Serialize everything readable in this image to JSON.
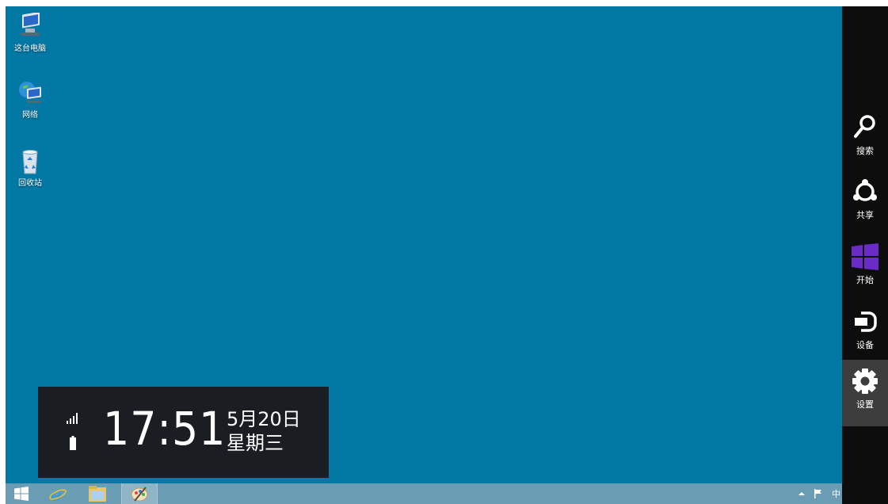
{
  "desktop": {
    "background_color": "#0278a4",
    "icons": [
      {
        "label": "这台电脑",
        "icon": "computer-icon"
      },
      {
        "label": "网络",
        "icon": "network-icon"
      },
      {
        "label": "回收站",
        "icon": "recycle-bin-icon"
      }
    ]
  },
  "clock": {
    "time": "17:51",
    "date": "5月20日",
    "weekday": "星期三",
    "status_icons": [
      "signal-icon",
      "battery-icon"
    ]
  },
  "taskbar": {
    "buttons": [
      {
        "icon": "windows-start-icon"
      },
      {
        "icon": "internet-explorer-icon"
      },
      {
        "icon": "file-explorer-icon"
      },
      {
        "icon": "paint-icon",
        "active": true
      }
    ],
    "tray": {
      "ime_label": "中",
      "icons": [
        "show-hidden-icons-chevron-icon",
        "action-center-flag-icon"
      ]
    }
  },
  "charms": {
    "items": [
      {
        "label": "搜索",
        "icon": "search-icon"
      },
      {
        "label": "共享",
        "icon": "share-icon"
      },
      {
        "label": "开始",
        "icon": "windows-start-icon"
      },
      {
        "label": "设备",
        "icon": "devices-icon"
      },
      {
        "label": "设置",
        "icon": "settings-gear-icon",
        "hover": true
      }
    ],
    "start_color": "#6a2bc6"
  }
}
